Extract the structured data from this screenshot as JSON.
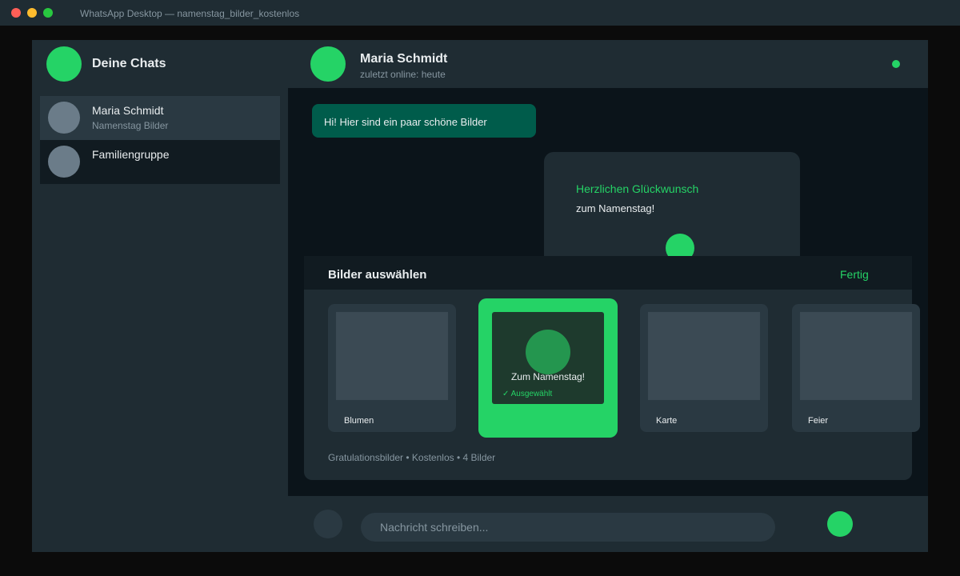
{
  "window": {
    "title": "WhatsApp Desktop — namenstag_bilder_kostenlos"
  },
  "sidebar": {
    "title": "Deine Chats",
    "chats": [
      {
        "name": "Maria Schmidt",
        "preview": "Namenstag Bilder",
        "active": true
      },
      {
        "name": "Familiengruppe",
        "preview": "",
        "active": false
      }
    ]
  },
  "conversation": {
    "contact_name": "Maria Schmidt",
    "status": "zuletzt online: heute",
    "messages": [
      {
        "type": "outgoing-text",
        "text": "Hi! Hier sind ein paar schöne Bilder"
      },
      {
        "type": "card",
        "line1": "Herzlichen Glückwunsch",
        "line2": "zum Namenstag!"
      }
    ]
  },
  "picker": {
    "title": "Bilder auswählen",
    "done_label": "Fertig",
    "tiles": [
      {
        "label": "Blumen",
        "selected": false
      },
      {
        "label": "Zum Namenstag!",
        "selected": true,
        "selected_label": "✓ Ausgewählt"
      },
      {
        "label": "Karte",
        "selected": false
      },
      {
        "label": "Feier",
        "selected": false
      }
    ],
    "footer": "Gratulationsbilder • Kostenlos • 4 Bilder"
  },
  "composer": {
    "placeholder": "Nachricht schreiben...",
    "emoji_icon": "emoji-icon",
    "send_icon": "send-icon"
  },
  "colors": {
    "accent": "#25d366",
    "outgoing_bubble": "#005c4b",
    "panel": "#1f2c33",
    "background": "#0b141a"
  }
}
